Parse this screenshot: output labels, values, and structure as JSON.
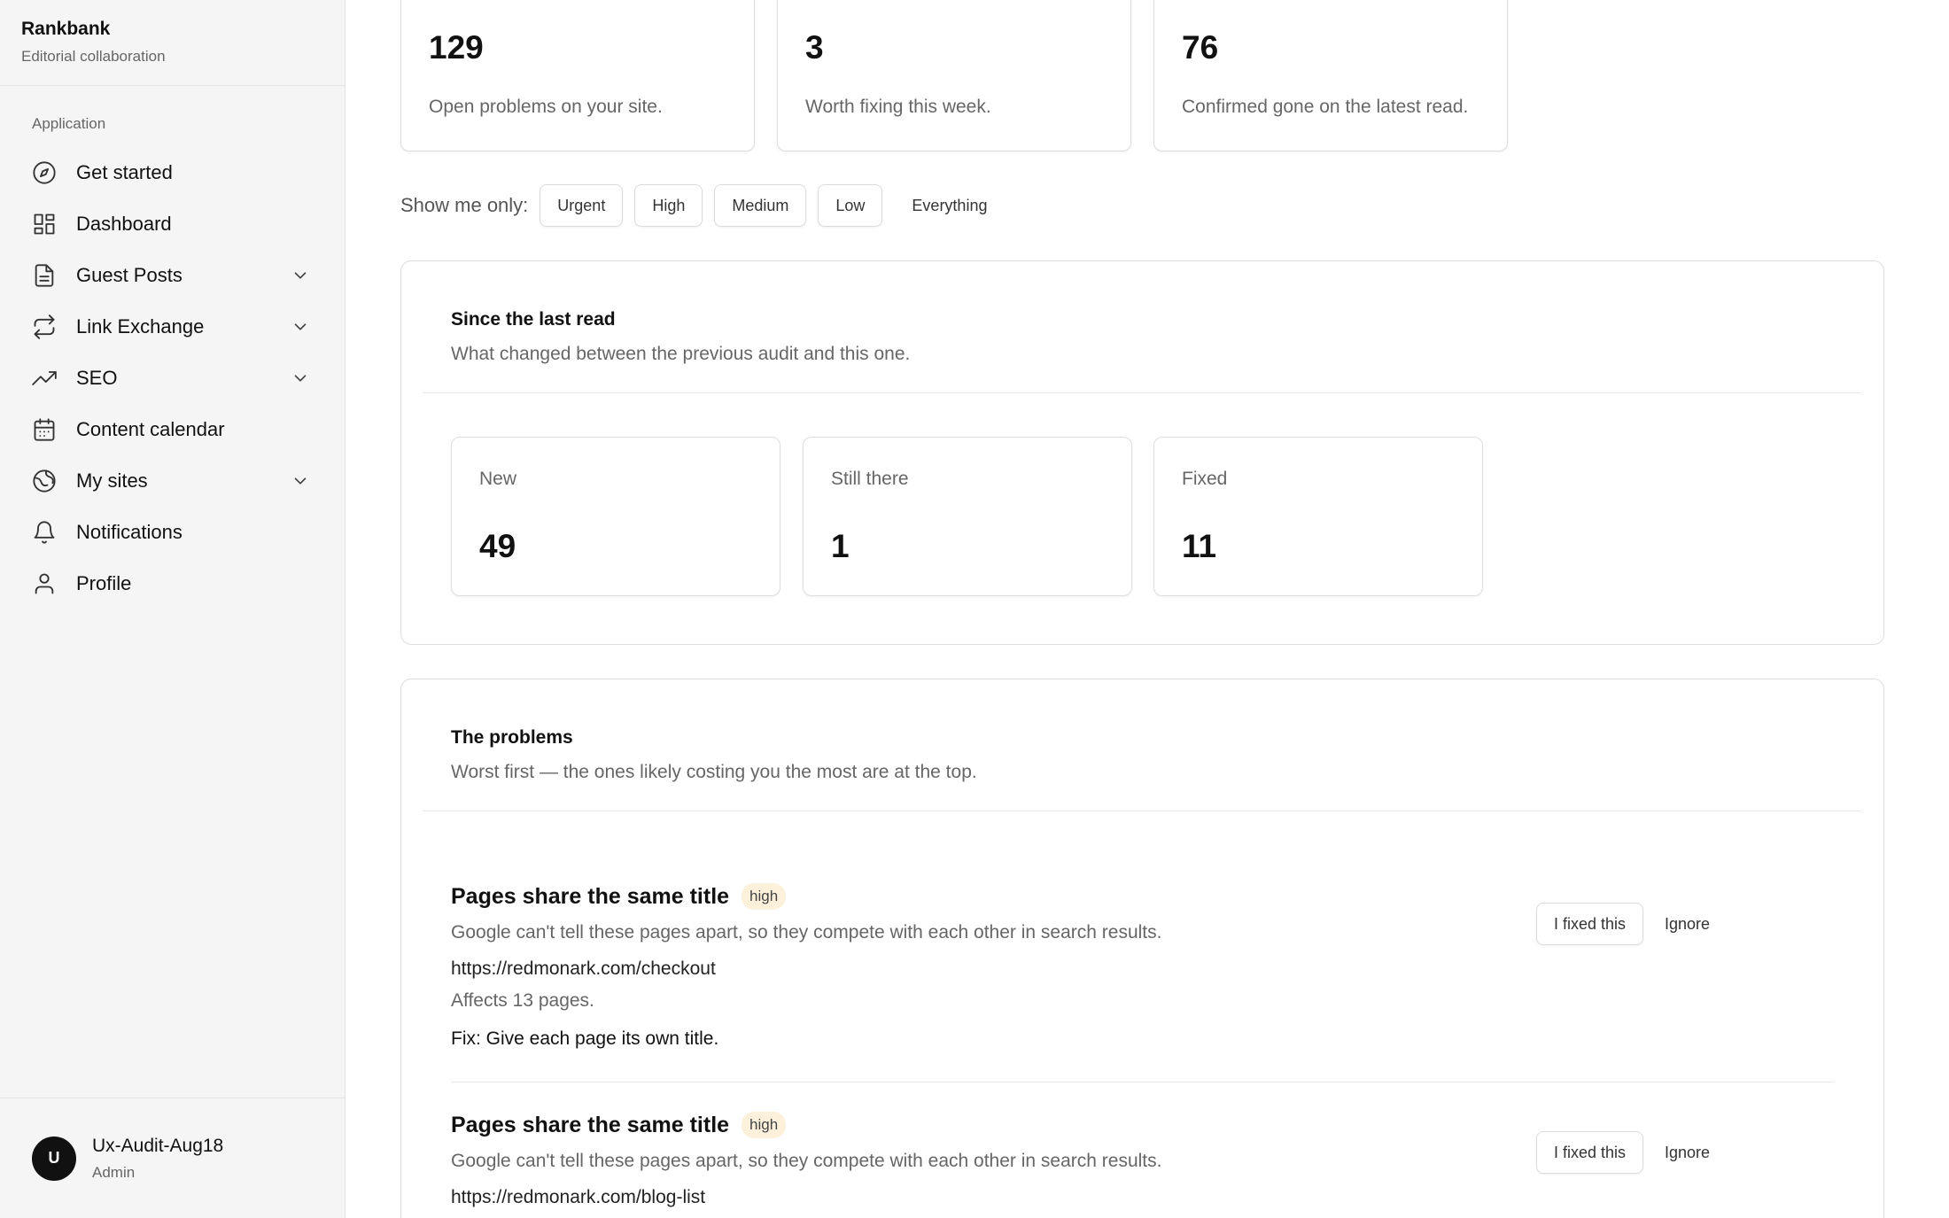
{
  "brand": {
    "name": "Rankbank",
    "subtitle": "Editorial collaboration"
  },
  "sidebar": {
    "section_label": "Application",
    "items": [
      {
        "label": "Get started",
        "icon": "compass-icon",
        "expandable": false
      },
      {
        "label": "Dashboard",
        "icon": "dashboard-icon",
        "expandable": false
      },
      {
        "label": "Guest Posts",
        "icon": "document-icon",
        "expandable": true
      },
      {
        "label": "Link Exchange",
        "icon": "exchange-icon",
        "expandable": true
      },
      {
        "label": "SEO",
        "icon": "trending-up-icon",
        "expandable": true
      },
      {
        "label": "Content calendar",
        "icon": "calendar-icon",
        "expandable": false
      },
      {
        "label": "My sites",
        "icon": "globe-icon",
        "expandable": true
      },
      {
        "label": "Notifications",
        "icon": "bell-icon",
        "expandable": false
      },
      {
        "label": "Profile",
        "icon": "user-icon",
        "expandable": false
      }
    ]
  },
  "user": {
    "initial": "U",
    "name": "Ux-Audit-Aug18",
    "role": "Admin"
  },
  "stats": [
    {
      "value": "129",
      "desc": "Open problems on your site."
    },
    {
      "value": "3",
      "desc": "Worth fixing this week."
    },
    {
      "value": "76",
      "desc": "Confirmed gone on the latest read."
    }
  ],
  "filters": {
    "label": "Show me only:",
    "options": [
      "Urgent",
      "High",
      "Medium",
      "Low",
      "Everything"
    ]
  },
  "since": {
    "title": "Since the last read",
    "subtitle": "What changed between the previous audit and this one.",
    "cards": [
      {
        "label": "New",
        "value": "49"
      },
      {
        "label": "Still there",
        "value": "1"
      },
      {
        "label": "Fixed",
        "value": "11"
      }
    ]
  },
  "problems": {
    "title": "The problems",
    "subtitle": "Worst first — the ones likely costing you the most are at the top.",
    "fixed_label": "I fixed this",
    "ignore_label": "Ignore",
    "items": [
      {
        "title": "Pages share the same title",
        "severity": "high",
        "desc": "Google can't tell these pages apart, so they compete with each other in search results.",
        "url": "https://redmonark.com/checkout",
        "affects": "Affects 13 pages.",
        "fix": "Fix: Give each page its own title."
      },
      {
        "title": "Pages share the same title",
        "severity": "high",
        "desc": "Google can't tell these pages apart, so they compete with each other in search results.",
        "url": "https://redmonark.com/blog-list"
      }
    ]
  }
}
